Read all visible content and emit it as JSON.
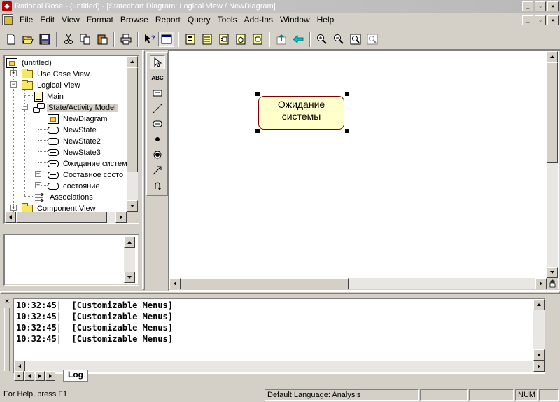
{
  "window": {
    "title": "Rational Rose - (untitled) - [Statechart Diagram: Logical View / NewDiagram]",
    "caption_buttons": [
      "_",
      "▫",
      "×"
    ]
  },
  "menubar": {
    "items": [
      {
        "label": "File",
        "key": "F"
      },
      {
        "label": "Edit",
        "key": "E"
      },
      {
        "label": "View",
        "key": "V"
      },
      {
        "label": "Format",
        "key": "o"
      },
      {
        "label": "Browse",
        "key": "B"
      },
      {
        "label": "Report",
        "key": "R"
      },
      {
        "label": "Query",
        "key": "Q"
      },
      {
        "label": "Tools",
        "key": "T"
      },
      {
        "label": "Add-Ins",
        "key": "A"
      },
      {
        "label": "Window",
        "key": "W"
      },
      {
        "label": "Help",
        "key": "H"
      }
    ]
  },
  "toolbar": {
    "icons": [
      "new-icon",
      "open-icon",
      "save-icon",
      "cut-icon",
      "copy-icon",
      "paste-icon",
      "print-icon",
      "context-help-icon",
      "view-doc-icon",
      "browse-class-icon",
      "browse-interaction-icon",
      "browse-component-icon",
      "browse-deployment-icon",
      "browse-parent-icon",
      "browse-previous-icon",
      "zoom-in-icon",
      "zoom-out-icon",
      "fit-window-icon",
      "undo-fit-icon"
    ]
  },
  "tree": {
    "nodes": [
      {
        "label": "(untitled)",
        "icon": "model-root-icon"
      },
      {
        "label": "Use Case View",
        "icon": "folder-icon",
        "expander": "+"
      },
      {
        "label": "Logical View",
        "icon": "folder-icon",
        "expander": "−"
      },
      {
        "label": "Main",
        "icon": "class-diagram-icon"
      },
      {
        "label": "State/Activity Model",
        "icon": "state-model-icon",
        "expander": "−",
        "selected": true
      },
      {
        "label": "NewDiagram",
        "icon": "statechart-diagram-icon"
      },
      {
        "label": "NewState",
        "icon": "state-icon"
      },
      {
        "label": "NewState2",
        "icon": "state-icon"
      },
      {
        "label": "NewState3",
        "icon": "state-icon"
      },
      {
        "label": "Ожидание систем",
        "icon": "state-icon"
      },
      {
        "label": "Составное состо",
        "icon": "state-icon",
        "expander": "+"
      },
      {
        "label": "состояние",
        "icon": "state-icon",
        "expander": "+"
      },
      {
        "label": "Associations",
        "icon": "associations-icon"
      },
      {
        "label": "Component View",
        "icon": "folder-icon",
        "expander": "+"
      }
    ]
  },
  "toolbox": {
    "tools": [
      "selection-tool-icon",
      "text-tool-icon",
      "note-tool-icon",
      "anchor-note-tool-icon",
      "state-tool-icon",
      "start-state-tool-icon",
      "end-state-tool-icon",
      "transition-tool-icon",
      "self-transition-tool-icon"
    ],
    "text_tool_label": "ABC"
  },
  "diagram": {
    "state_label_line1": "Ожидание",
    "state_label_line2": "системы"
  },
  "log": {
    "lines": [
      "10:32:45|  [Customizable Menus]",
      "10:32:45|  [Customizable Menus]",
      "10:32:45|  [Customizable Menus]",
      "10:32:45|  [Customizable Menus]"
    ],
    "tab_label": "Log"
  },
  "statusbar": {
    "help": "For Help, press F1",
    "language": "Default Language: Analysis",
    "num": "NUM"
  },
  "colors": {
    "state_fill": "#ffffcc",
    "state_border": "#800000",
    "title_bar": "#c0c0c0"
  }
}
